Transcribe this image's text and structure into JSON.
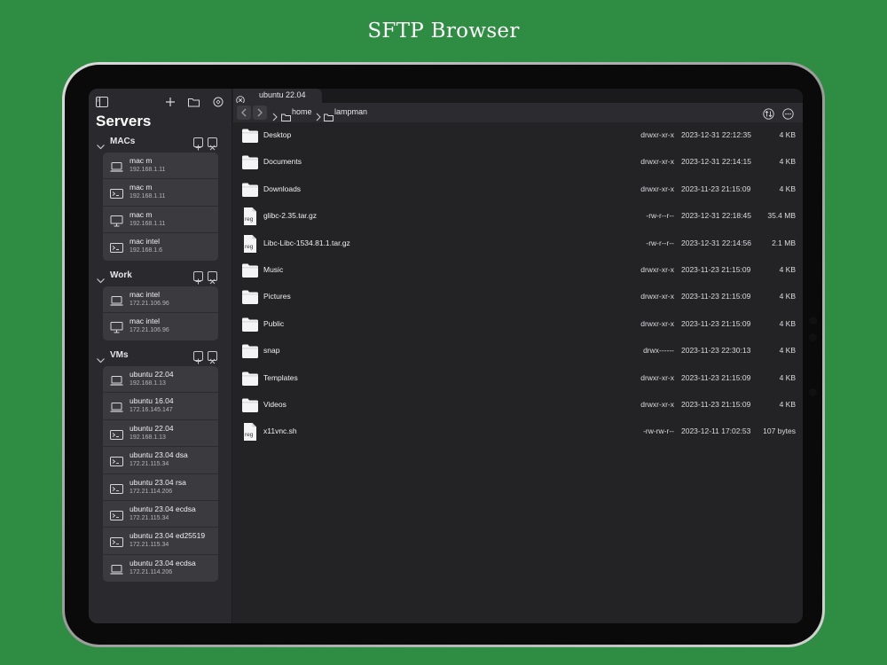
{
  "page": {
    "headline": "SFTP Browser",
    "background": "#2f8c43"
  },
  "sidebar": {
    "title": "Servers",
    "toolbar_icons": [
      "sidebar-toggle-icon",
      "plus-icon",
      "folder-icon",
      "settings-icon"
    ],
    "groups": [
      {
        "name": "MACs",
        "servers": [
          {
            "name": "mac m",
            "ip": "192.168.1.11",
            "icon": "laptop-icon"
          },
          {
            "name": "mac m",
            "ip": "192.168.1.11",
            "icon": "terminal-icon"
          },
          {
            "name": "mac m",
            "ip": "192.168.1.11",
            "icon": "desktop-icon"
          },
          {
            "name": "mac intel",
            "ip": "192.168.1.6",
            "icon": "terminal-icon"
          }
        ]
      },
      {
        "name": "Work",
        "servers": [
          {
            "name": "mac intel",
            "ip": "172.21.106.96",
            "icon": "laptop-icon"
          },
          {
            "name": "mac intel",
            "ip": "172.21.106.96",
            "icon": "desktop-icon"
          }
        ]
      },
      {
        "name": "VMs",
        "servers": [
          {
            "name": "ubuntu 22.04",
            "ip": "192.168.1.13",
            "icon": "laptop-icon"
          },
          {
            "name": "ubuntu 16.04",
            "ip": "172.16.145.147",
            "icon": "laptop-icon"
          },
          {
            "name": "ubuntu 22.04",
            "ip": "192.168.1.13",
            "icon": "terminal-icon"
          },
          {
            "name": "ubuntu 23.04 dsa",
            "ip": "172.21.115.34",
            "icon": "terminal-icon"
          },
          {
            "name": "ubuntu 23.04 rsa",
            "ip": "172.21.114.206",
            "icon": "terminal-icon"
          },
          {
            "name": "ubuntu 23.04 ecdsa",
            "ip": "172.21.115.34",
            "icon": "terminal-icon"
          },
          {
            "name": "ubuntu 23.04 ed25519",
            "ip": "172.21.115.34",
            "icon": "terminal-icon"
          },
          {
            "name": "ubuntu 23.04 ecdsa",
            "ip": "172.21.114.206",
            "icon": "laptop-icon"
          }
        ]
      }
    ]
  },
  "tab": {
    "label": "ubuntu 22.04"
  },
  "path": {
    "segments": [
      "home",
      "lampman"
    ]
  },
  "files": [
    {
      "name": "Desktop",
      "type": "folder",
      "perms": "drwxr-xr-x",
      "date": "2023-12-31 22:12:35",
      "size": "4 KB"
    },
    {
      "name": "Documents",
      "type": "folder",
      "perms": "drwxr-xr-x",
      "date": "2023-12-31 22:14:15",
      "size": "4 KB"
    },
    {
      "name": "Downloads",
      "type": "folder",
      "perms": "drwxr-xr-x",
      "date": "2023-11-23 21:15:09",
      "size": "4 KB"
    },
    {
      "name": "glibc-2.35.tar.gz",
      "type": "reg",
      "perms": "-rw-r--r--",
      "date": "2023-12-31 22:18:45",
      "size": "35.4 MB"
    },
    {
      "name": "Libc-Libc-1534.81.1.tar.gz",
      "type": "reg",
      "perms": "-rw-r--r--",
      "date": "2023-12-31 22:14:56",
      "size": "2.1 MB"
    },
    {
      "name": "Music",
      "type": "folder",
      "perms": "drwxr-xr-x",
      "date": "2023-11-23 21:15:09",
      "size": "4 KB"
    },
    {
      "name": "Pictures",
      "type": "folder",
      "perms": "drwxr-xr-x",
      "date": "2023-11-23 21:15:09",
      "size": "4 KB"
    },
    {
      "name": "Public",
      "type": "folder",
      "perms": "drwxr-xr-x",
      "date": "2023-11-23 21:15:09",
      "size": "4 KB"
    },
    {
      "name": "snap",
      "type": "folder",
      "perms": "drwx------",
      "date": "2023-11-23 22:30:13",
      "size": "4 KB"
    },
    {
      "name": "Templates",
      "type": "folder",
      "perms": "drwxr-xr-x",
      "date": "2023-11-23 21:15:09",
      "size": "4 KB"
    },
    {
      "name": "Videos",
      "type": "folder",
      "perms": "drwxr-xr-x",
      "date": "2023-11-23 21:15:09",
      "size": "4 KB"
    },
    {
      "name": "x11vnc.sh",
      "type": "reg",
      "perms": "-rw-rw-r--",
      "date": "2023-12-11 17:02:53",
      "size": "107 bytes"
    }
  ],
  "file_icon_label": "reg"
}
